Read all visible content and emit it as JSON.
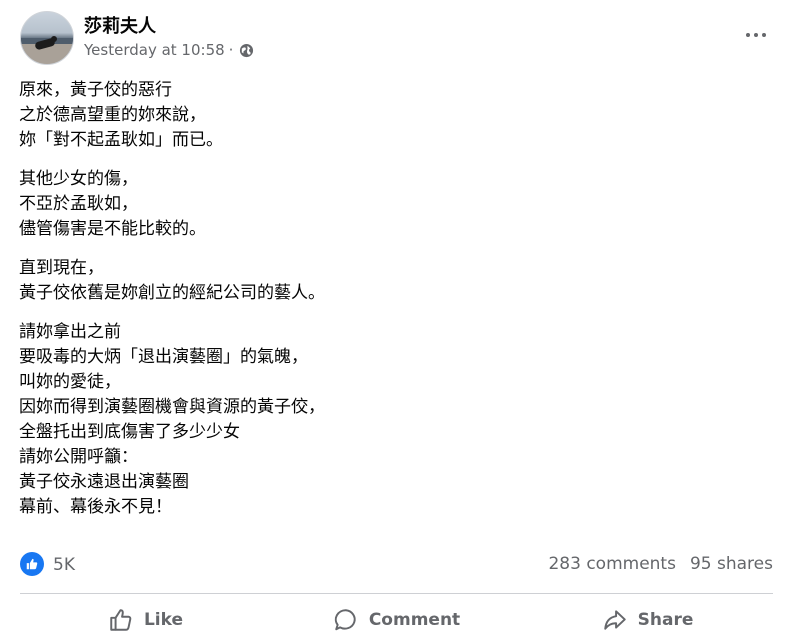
{
  "post": {
    "author": "莎莉夫人",
    "timestamp": "Yesterday at 10:58",
    "separator": "·",
    "privacy_icon": "globe-icon",
    "body": [
      [
        "原來，黃子佼的惡行",
        "之於德高望重的妳來說，",
        "妳「對不起孟耿如」而已。"
      ],
      [
        "其他少女的傷，",
        "不亞於孟耿如，",
        "儘管傷害是不能比較的。"
      ],
      [
        "直到現在，",
        "黃子佼依舊是妳創立的經紀公司的藝人。"
      ],
      [
        "請妳拿出之前",
        "要吸毒的大炳「退出演藝圈」的氣魄，",
        "叫妳的愛徒，",
        "因妳而得到演藝圈機會與資源的黃子佼，",
        "全盤托出到底傷害了多少少女",
        "請妳公開呼籲：",
        "黃子佼永遠退出演藝圈",
        "幕前、幕後永不見！"
      ]
    ]
  },
  "reactions": {
    "icon": "like-badge-icon",
    "count": "5K",
    "comments": "283 comments",
    "shares": "95 shares"
  },
  "actions": {
    "like": "Like",
    "comment": "Comment",
    "share": "Share"
  },
  "colors": {
    "accent": "#1877f2",
    "secondary_text": "#65676b",
    "primary_text": "#050505",
    "divider": "#ced0d4"
  }
}
